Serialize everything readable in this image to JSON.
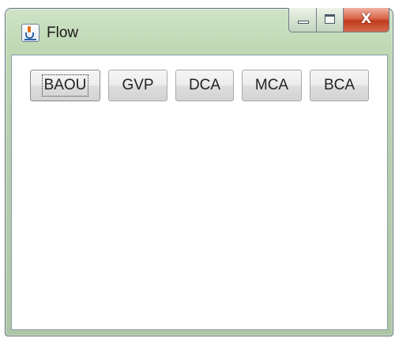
{
  "window": {
    "title": "Flow",
    "icon": "java-cup-icon"
  },
  "caption_buttons": {
    "minimize_icon": "minimize-icon",
    "maximize_icon": "maximize-icon",
    "close_label": "X"
  },
  "buttons": [
    {
      "label": "BAOU",
      "focused": true
    },
    {
      "label": "GVP",
      "focused": false
    },
    {
      "label": "DCA",
      "focused": false
    },
    {
      "label": "MCA",
      "focused": false
    },
    {
      "label": "BCA",
      "focused": false
    }
  ],
  "colors": {
    "title_bar": "#c0d8b4",
    "close_button": "#c13a1c",
    "button_face": "#ececec"
  }
}
